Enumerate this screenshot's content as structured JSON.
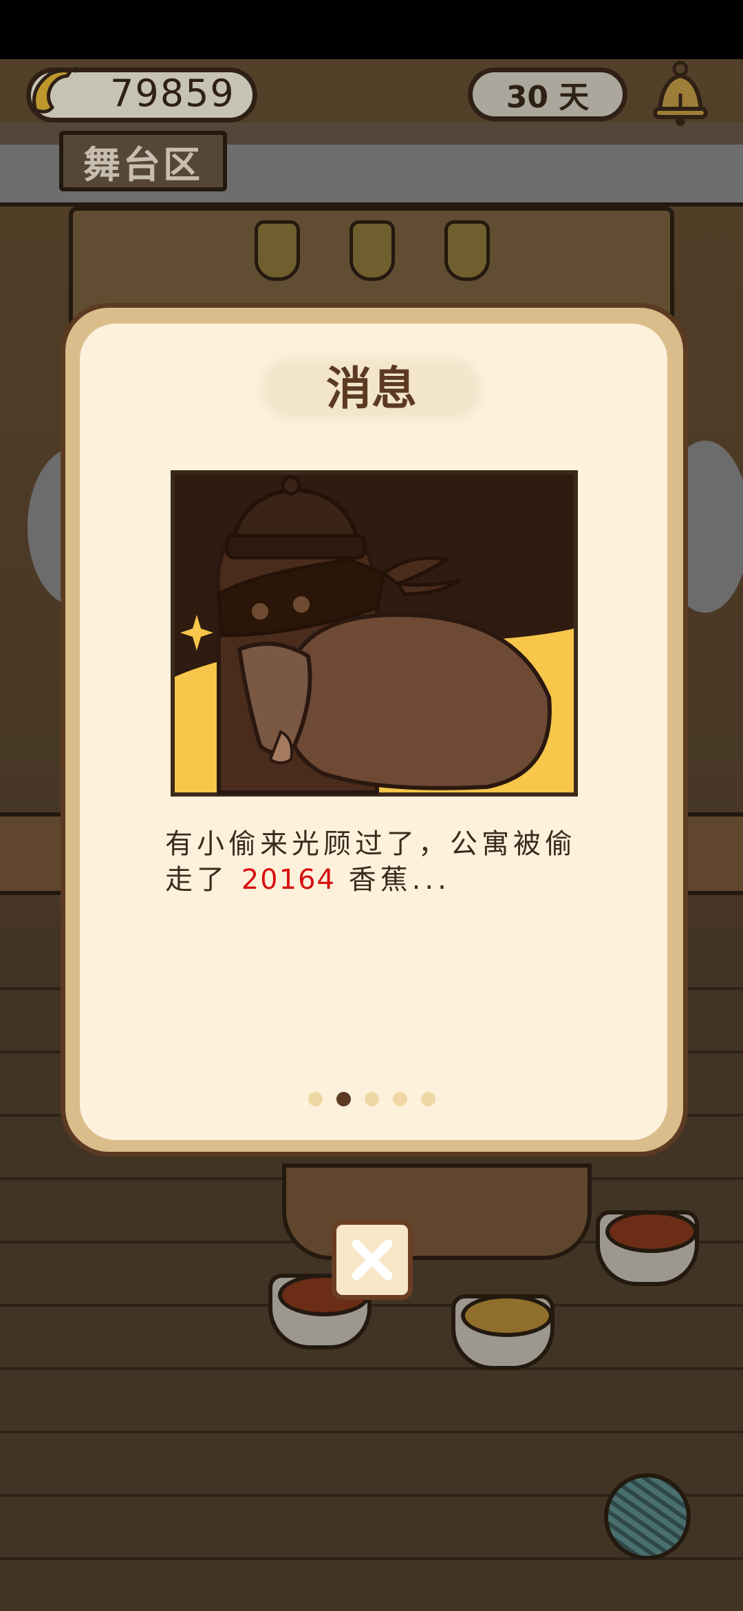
{
  "hud": {
    "banana_count": "79859",
    "days_label": "30 天",
    "area_sign": "舞台区"
  },
  "dialog": {
    "title": "消息",
    "message_part1": "有小偷来光顾过了，公寓被偷走了",
    "stolen_amount": "20164",
    "message_part2": "香蕉...",
    "page_total": 5,
    "page_active": 2
  },
  "icons": {
    "banana": "banana-icon",
    "bell": "bell-icon",
    "close": "close-icon",
    "yarn": "yarn-ball-icon"
  },
  "colors": {
    "amount_highlight": "#d81010",
    "dialog_border": "#5c3a22",
    "dialog_fill": "#fdf1dc"
  }
}
